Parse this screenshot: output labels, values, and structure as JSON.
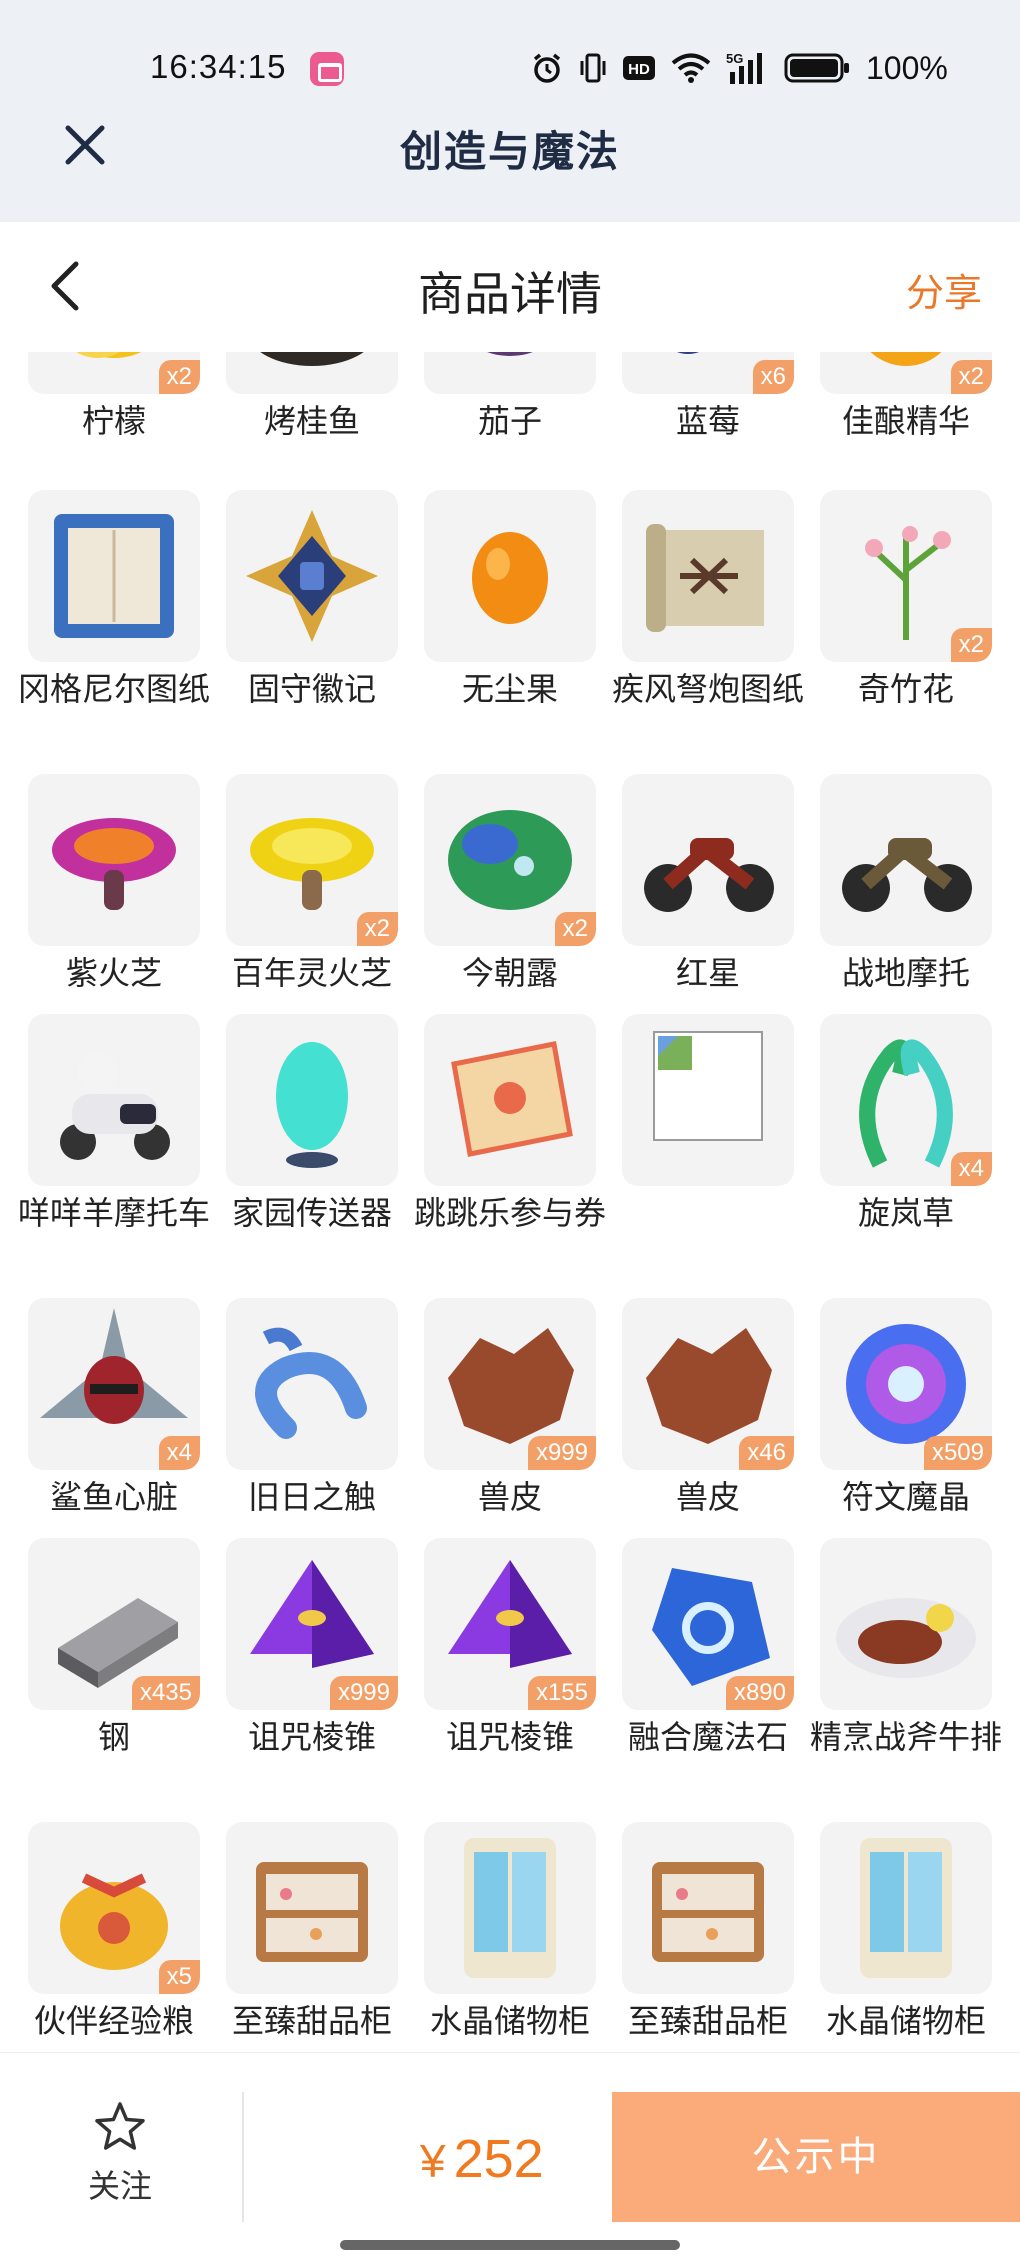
{
  "status_bar": {
    "time": "16:34:15",
    "network": "5G",
    "hd": "HD",
    "battery": "100%"
  },
  "app": {
    "title": "创造与魔法"
  },
  "page": {
    "title": "商品详情",
    "share": "分享"
  },
  "items": [
    {
      "name": "柠檬",
      "qty": "x2",
      "icon": "lemon",
      "color": "#f4c21b"
    },
    {
      "name": "烤桂鱼",
      "qty": "",
      "icon": "grilled-fish",
      "color": "#4a3a2c"
    },
    {
      "name": "茄子",
      "qty": "",
      "icon": "eggplant",
      "color": "#5b3a73"
    },
    {
      "name": "蓝莓",
      "qty": "x6",
      "icon": "blueberry",
      "color": "#2d3c8c"
    },
    {
      "name": "佳酿精华",
      "qty": "x2",
      "icon": "essence-orb",
      "color": "#f3a515"
    },
    {
      "name": "冈格尼尔图纸",
      "qty": "",
      "icon": "blueprint-frame",
      "color": "#3b6fbf"
    },
    {
      "name": "固守徽记",
      "qty": "",
      "icon": "emblem",
      "color": "#d9a53a"
    },
    {
      "name": "无尘果",
      "qty": "",
      "icon": "fruit",
      "color": "#f28c12"
    },
    {
      "name": "疾风弩炮图纸",
      "qty": "",
      "icon": "scroll",
      "color": "#d8cdaf"
    },
    {
      "name": "奇竹花",
      "qty": "x2",
      "icon": "bamboo-flower",
      "color": "#5ea23a"
    },
    {
      "name": "紫火芝",
      "qty": "",
      "icon": "purple-mushroom",
      "color": "#c2309d"
    },
    {
      "name": "百年灵火芝",
      "qty": "x2",
      "icon": "yellow-mushroom",
      "color": "#f0d214"
    },
    {
      "name": "今朝露",
      "qty": "x2",
      "icon": "dew-leaf",
      "color": "#2e9a57"
    },
    {
      "name": "红星",
      "qty": "",
      "icon": "motorcycle",
      "color": "#8c2b1e"
    },
    {
      "name": "战地摩托",
      "qty": "",
      "icon": "motorcycle",
      "color": "#6a5a3a"
    },
    {
      "name": "咩咩羊摩托车",
      "qty": "",
      "icon": "scooter",
      "color": "#e8e8ec"
    },
    {
      "name": "家园传送器",
      "qty": "",
      "icon": "teleporter",
      "color": "#44e0d2"
    },
    {
      "name": "跳跳乐参与券",
      "qty": "",
      "icon": "ticket",
      "color": "#e86a4a"
    },
    {
      "name": "",
      "qty": "",
      "icon": "broken-image",
      "color": "#aaaaaa"
    },
    {
      "name": "旋岚草",
      "qty": "x4",
      "icon": "swirl-grass",
      "color": "#2fb36a"
    },
    {
      "name": "鲨鱼心脏",
      "qty": "x4",
      "icon": "shark-heart",
      "color": "#a0242c"
    },
    {
      "name": "旧日之触",
      "qty": "",
      "icon": "tentacle",
      "color": "#5a8fe0"
    },
    {
      "name": "兽皮",
      "qty": "x999",
      "icon": "hide",
      "color": "#9a4a2c"
    },
    {
      "name": "兽皮",
      "qty": "x46",
      "icon": "hide",
      "color": "#9a4a2c"
    },
    {
      "name": "符文魔晶",
      "qty": "x509",
      "icon": "rune-orb",
      "color": "#4a6ef0"
    },
    {
      "name": "钢",
      "qty": "x435",
      "icon": "steel-ingot",
      "color": "#7d7d80"
    },
    {
      "name": "诅咒棱锥",
      "qty": "x999",
      "icon": "pyramid",
      "color": "#8a3ae0"
    },
    {
      "name": "诅咒棱锥",
      "qty": "x155",
      "icon": "pyramid",
      "color": "#8a3ae0"
    },
    {
      "name": "融合魔法石",
      "qty": "x890",
      "icon": "magic-stone",
      "color": "#2d66d8"
    },
    {
      "name": "精烹战斧牛排",
      "qty": "",
      "icon": "steak-plate",
      "color": "#8a3a22"
    },
    {
      "name": "伙伴经验粮",
      "qty": "x5",
      "icon": "food-bag",
      "color": "#f0b52a"
    },
    {
      "name": "至臻甜品柜",
      "qty": "",
      "icon": "dessert-cabinet",
      "color": "#b87a44"
    },
    {
      "name": "水晶储物柜",
      "qty": "",
      "icon": "crystal-cabinet",
      "color": "#7ec8e8"
    },
    {
      "name": "至臻甜品柜",
      "qty": "",
      "icon": "dessert-cabinet",
      "color": "#b87a44"
    },
    {
      "name": "水晶储物柜",
      "qty": "",
      "icon": "crystal-cabinet",
      "color": "#7ec8e8"
    }
  ],
  "bottom": {
    "follow_label": "关注",
    "currency": "¥",
    "price": "252",
    "cta": "公示中"
  },
  "colors": {
    "accent": "#e8782b",
    "cta_bg": "#fbaa7a",
    "badge_bg": "#f2a068"
  }
}
